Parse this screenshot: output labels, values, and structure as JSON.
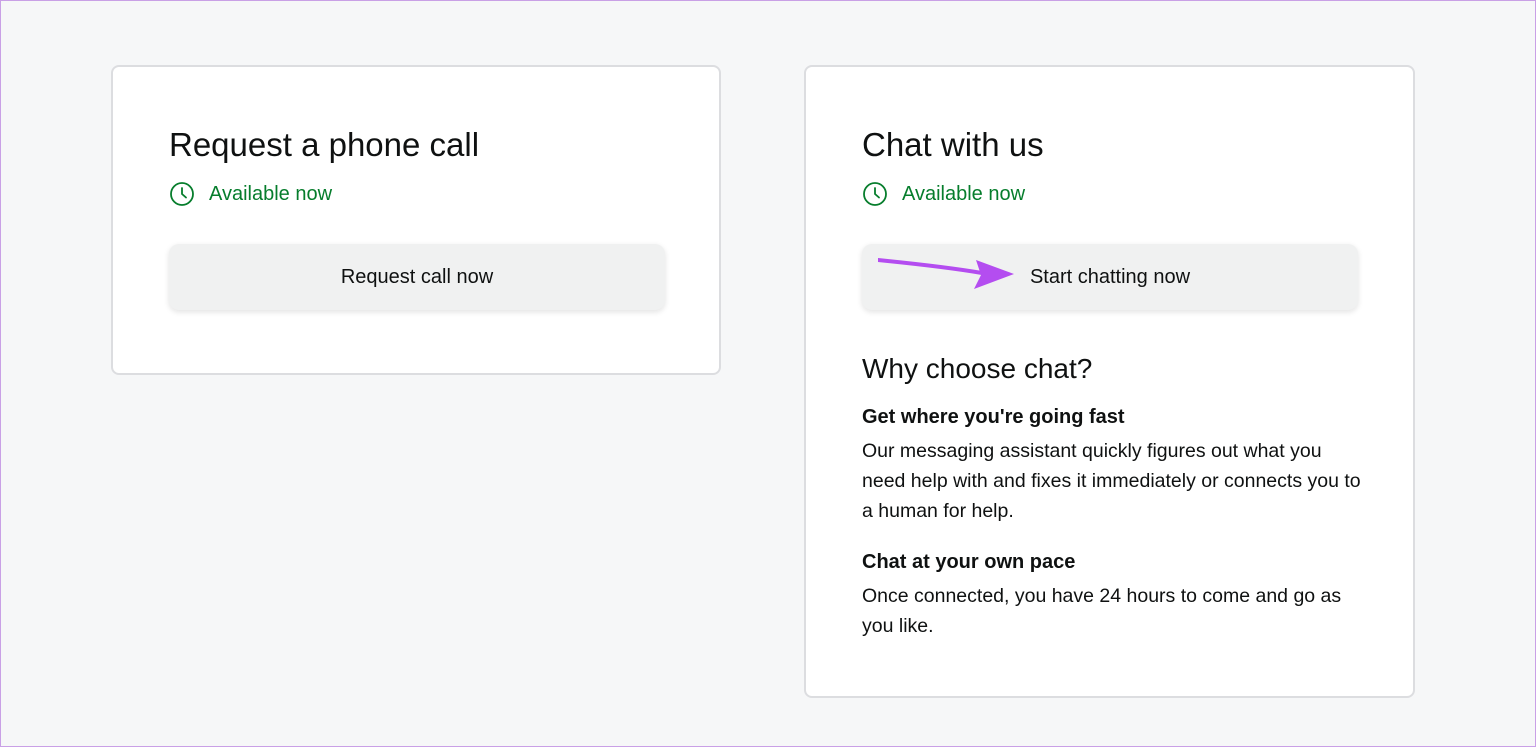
{
  "phone_card": {
    "title": "Request a phone call",
    "availability": "Available now",
    "button_label": "Request call now"
  },
  "chat_card": {
    "title": "Chat with us",
    "availability": "Available now",
    "button_label": "Start chatting now",
    "why_heading": "Why choose chat?",
    "benefits": [
      {
        "heading": "Get where you're going fast",
        "text": "Our messaging assistant quickly figures out what you need help with and fixes it immediately or connects you to a human for help."
      },
      {
        "heading": "Chat at your own pace",
        "text": "Once connected, you have 24 hours to come and go as you like."
      }
    ]
  },
  "icons": {
    "availability": "clock-icon",
    "annotation": "arrow-icon"
  },
  "colors": {
    "available_green": "#067d2c",
    "annotation_purple": "#b44df0",
    "button_bg": "#f0f1f1"
  }
}
